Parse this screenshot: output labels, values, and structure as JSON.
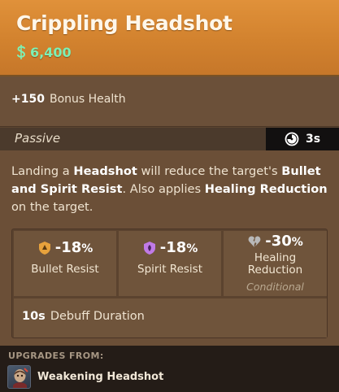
{
  "item": {
    "title": "Crippling Headshot",
    "cost": "6,400",
    "cost_icon": "souls-currency-icon"
  },
  "bonus": {
    "value": "+150",
    "label": "Bonus Health"
  },
  "passive": {
    "label": "Passive",
    "cooldown": "3s",
    "cooldown_icon": "clock-icon"
  },
  "description": {
    "p1": "Landing a ",
    "b1": "Headshot",
    "p2": " will reduce the target's ",
    "b2": "Bullet and Spirit Resist",
    "p3": ". Also applies ",
    "b3": "Healing Reduction",
    "p4": " on the target."
  },
  "stats": [
    {
      "value": "-18",
      "unit": "%",
      "label": "Bullet Resist",
      "icon": "bullet-shield-icon",
      "color": "#e8a23c"
    },
    {
      "value": "-18",
      "unit": "%",
      "label": "Spirit Resist",
      "icon": "spirit-shield-icon",
      "color": "#c07ae6"
    },
    {
      "value": "-30",
      "unit": "%",
      "label": "Healing Reduction",
      "label_line1": "Healing",
      "label_line2": "Reduction",
      "note": "Conditional",
      "icon": "broken-heart-icon",
      "color": "#b8b8b8"
    }
  ],
  "debuff": {
    "value": "10s",
    "label": "Debuff Duration"
  },
  "upgrades": {
    "heading": "UPGRADES FROM:",
    "items": [
      {
        "name": "Weakening Headshot",
        "icon": "weakening-headshot-icon"
      }
    ]
  },
  "colors": {
    "header": "#d2822e",
    "cost": "#7df0b5",
    "body": "#6b4f37"
  }
}
